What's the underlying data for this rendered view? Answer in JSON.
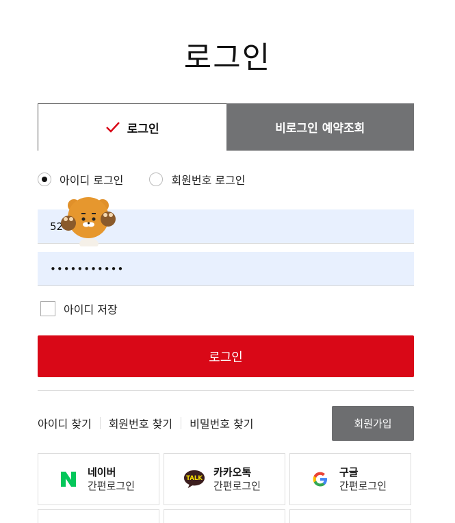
{
  "page": {
    "title": "로그인"
  },
  "tabs": [
    {
      "label": "로그인",
      "active": true
    },
    {
      "label": "비로그인 예약조회",
      "active": false
    }
  ],
  "login_type": {
    "options": [
      {
        "label": "아이디 로그인",
        "selected": true
      },
      {
        "label": "회원번호 로그인",
        "selected": false
      }
    ]
  },
  "form": {
    "id_value": "52",
    "password_value": "•••••••••••",
    "save_id_label": "아이디 저장",
    "save_id_checked": false,
    "submit_label": "로그인"
  },
  "links": {
    "find_id": "아이디 찾기",
    "find_member_no": "회원번호 찾기",
    "find_password": "비밀번호 찾기",
    "join": "회원가입"
  },
  "social": [
    {
      "name": "네이버",
      "sub": "간편로그인",
      "icon": "naver-icon",
      "color": "#03c75a"
    },
    {
      "name": "카카오톡",
      "sub": "간편로그인",
      "icon": "kakaotalk-icon",
      "color": "#3c1e1e"
    },
    {
      "name": "구글",
      "sub": "간편로그인",
      "icon": "google-icon",
      "color": "#4285f4"
    }
  ],
  "colors": {
    "primary": "#d90817",
    "tab_inactive": "#717274",
    "input_bg": "#e8f0fe"
  }
}
